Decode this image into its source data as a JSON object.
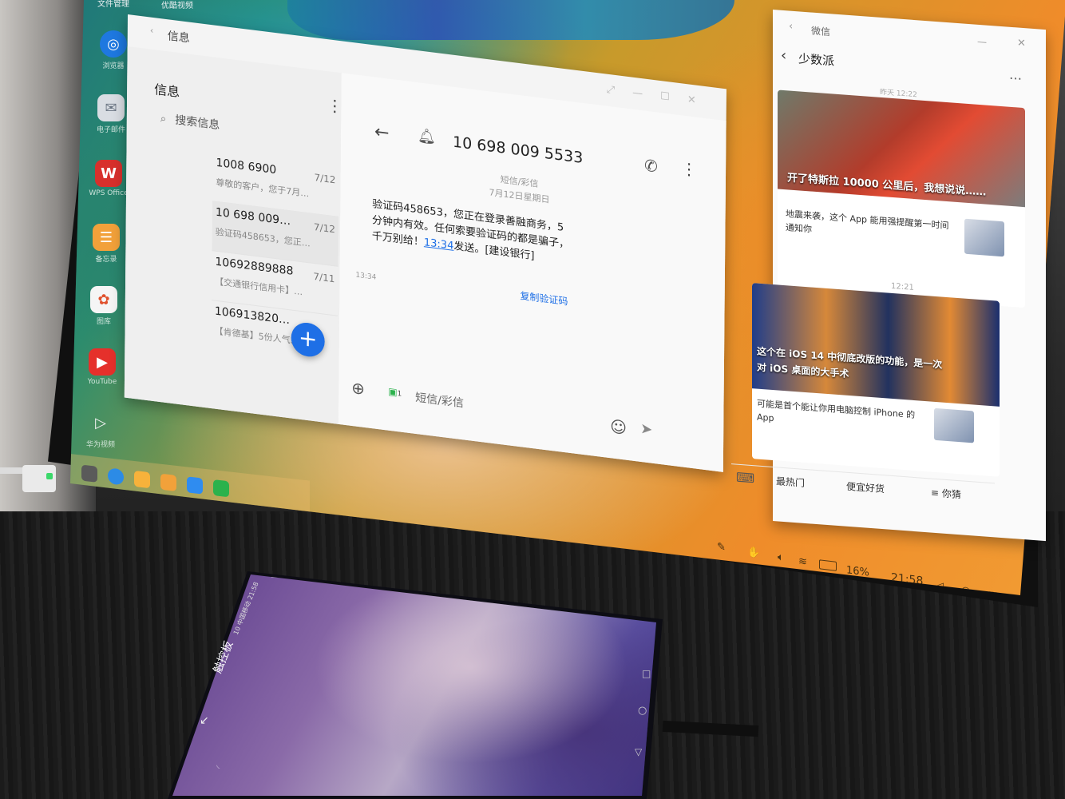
{
  "desktop": {
    "top_labels": [
      "文件管理",
      "优酷视频"
    ],
    "apps": [
      {
        "label": "浏览器",
        "icon": "browser-icon",
        "color": "#1e78e0"
      },
      {
        "label": "电子邮件",
        "icon": "email-icon",
        "color": "#d9dde3"
      },
      {
        "label": "WPS Office",
        "icon": "wps-icon",
        "color": "#d8302c"
      },
      {
        "label": "备忘录",
        "icon": "notes-icon",
        "color": "#f2a13a"
      },
      {
        "label": "图库",
        "icon": "gallery-icon",
        "color": "#f5f5f5"
      },
      {
        "label": "YouTube",
        "icon": "youtube-icon",
        "color": "#e5302b"
      },
      {
        "label": "华为视频",
        "icon": "video-icon",
        "color": "#3a3a3a"
      }
    ]
  },
  "messages_window": {
    "titlebar_title": "信息",
    "sidebar_title": "信息",
    "search_placeholder": "搜索信息",
    "conversations": [
      {
        "name": "1008 6900",
        "date": "7/12",
        "preview": "尊敬的客户，您于7月…"
      },
      {
        "name": "10 698 009…",
        "date": "7/12",
        "preview": "验证码458653，您正…"
      },
      {
        "name": "10692889888",
        "date": "7/11",
        "preview": "【交通银行信用卡】…"
      },
      {
        "name": "106913820…",
        "date": "",
        "preview": "【肯德基】5份人气…"
      }
    ],
    "new_message_symbol": "+",
    "chat": {
      "contact": "10 698 009 5533",
      "channel_label": "短信/彩信",
      "date_label": "7月12日星期日",
      "message_part1": "验证码458653，您正在登录善融商务，5分钟内有效。任何索要验证码的都是骗子，千万别给！",
      "message_time_link": "13:34",
      "message_part2": "发送。[建设银行]",
      "message_time": "13:34",
      "copy_code_label": "复制验证码",
      "input_placeholder": "短信/彩信",
      "sim_label": "1"
    }
  },
  "wechat_window": {
    "titlebar_title": "微信",
    "account_name": "少数派",
    "time_1": "昨天 12:22",
    "article_1_title": "开了特斯拉 10000 公里后，我想说说……",
    "article_2_title": "地震来袭，这个 App 能用强提醒第一时间通知你",
    "time_2": "12:21",
    "article_3_title_line1": "这个在 iOS 14 中彻底改版的功能，是一次",
    "article_3_title_line2": "对 iOS 桌面的大手术",
    "article_4_title": "可能是首个能让你用电脑控制 iPhone 的 App",
    "menu_items": [
      "最热门",
      "便宜好货",
      "≡ 你猜"
    ]
  },
  "taskbar": {
    "apps": [
      {
        "icon": "launcher-icon",
        "color": "#5a5a5a"
      },
      {
        "icon": "browser-icon",
        "color": "#2c8be6"
      },
      {
        "icon": "gallery-icon",
        "color": "#f7b23b"
      },
      {
        "icon": "notes-icon",
        "color": "#f2a13a"
      },
      {
        "icon": "messages-icon",
        "color": "#2f8cf0"
      },
      {
        "icon": "wechat-icon",
        "color": "#2bb24c"
      }
    ]
  },
  "system_tray": {
    "battery": "16%",
    "clock": "21:58"
  },
  "phone": {
    "touchpad_label": "触控板",
    "status_text": "10 中国移动 21:58"
  }
}
